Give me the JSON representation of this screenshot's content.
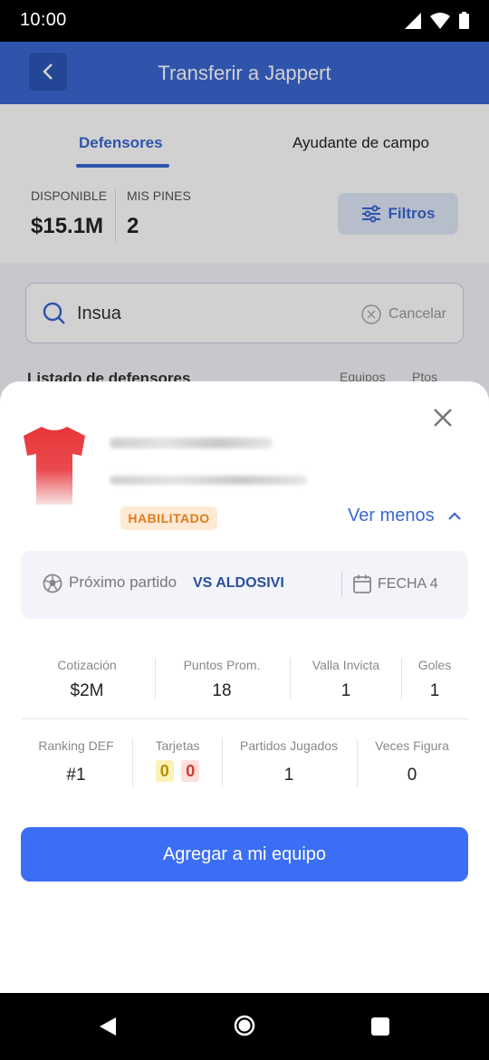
{
  "status_bar": {
    "time": "10:00"
  },
  "header": {
    "title": "Transferir a Jappert"
  },
  "tabs": [
    {
      "label": "Defensores",
      "active": true
    },
    {
      "label": "Ayudante de campo",
      "active": false
    }
  ],
  "budget": {
    "available_label": "DISPONIBLE",
    "available_value": "$15.1M",
    "pins_label": "MIS PINES",
    "pins_value": "2",
    "filter_label": "Filtros"
  },
  "search": {
    "value": "Insua",
    "cancel_label": "Cancelar"
  },
  "list_header": {
    "title": "Listado de defensores",
    "col_teams": "Equipos",
    "col_points": "Ptos"
  },
  "player": {
    "status_badge": "HABILITADO",
    "toggle_label": "Ver menos",
    "jersey_color": "#e8353a"
  },
  "match": {
    "label": "Próximo partido",
    "opponent": "VS ALDOSIVI",
    "round": "FECHA 4"
  },
  "stats_row1": [
    {
      "label": "Cotización",
      "value": "$2M"
    },
    {
      "label": "Puntos Prom.",
      "value": "18"
    },
    {
      "label": "Valla Invicta",
      "value": "1"
    },
    {
      "label": "Goles",
      "value": "1"
    }
  ],
  "stats_row2": {
    "ranking": {
      "label": "Ranking DEF",
      "value": "#1"
    },
    "cards": {
      "label": "Tarjetas",
      "yellow": "0",
      "red": "0"
    },
    "matches": {
      "label": "Partidos Jugados",
      "value": "1"
    },
    "figure": {
      "label": "Veces Figura",
      "value": "0"
    }
  },
  "add_button": {
    "label": "Agregar a mi equipo"
  },
  "colors": {
    "primary": "#3a67d2",
    "button": "#3b6ef5",
    "badge_text": "#e07b1a",
    "badge_bg": "#fde9d4"
  }
}
